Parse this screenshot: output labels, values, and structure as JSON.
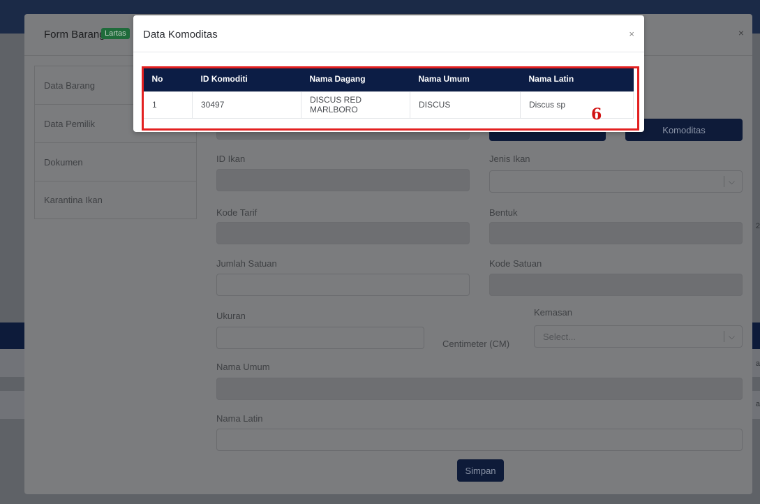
{
  "background": {
    "edge_text_1": "2",
    "edge_text_2": "a",
    "edge_text_3": "a"
  },
  "form": {
    "title": "Form Barang",
    "badge": "Lartas",
    "close": "×",
    "side_nav": [
      "Data Barang",
      "Data Pemilik",
      "Dokumen",
      "Karantina Ikan"
    ],
    "fields": {
      "id_ikan": {
        "label": "ID Ikan",
        "value": ""
      },
      "jenis_ikan": {
        "label": "Jenis Ikan",
        "value": ""
      },
      "kode_tarif": {
        "label": "Kode Tarif",
        "value": ""
      },
      "bentuk": {
        "label": "Bentuk",
        "value": ""
      },
      "jumlah_satuan": {
        "label": "Jumlah Satuan",
        "value": ""
      },
      "kode_satuan": {
        "label": "Kode Satuan",
        "value": ""
      },
      "ukuran": {
        "label": "Ukuran",
        "value": "",
        "unit": "Centimeter (CM)"
      },
      "kemasan": {
        "label": "Kemasan",
        "placeholder": "Select..."
      },
      "nama_umum": {
        "label": "Nama Umum",
        "value": ""
      },
      "nama_latin": {
        "label": "Nama Latin",
        "value": ""
      }
    },
    "buttons": {
      "komoditas": "Komoditas",
      "simpan": "Simpan"
    }
  },
  "dialog": {
    "title": "Data Komoditas",
    "close": "×",
    "columns": [
      "No",
      "ID Komoditi",
      "Nama Dagang",
      "Nama Umum",
      "Nama Latin"
    ],
    "rows": [
      [
        "1",
        "30497",
        "DISCUS RED MARLBORO",
        "DISCUS",
        "Discus sp"
      ]
    ]
  },
  "annotation": {
    "number": "6",
    "color": "#e32020"
  },
  "colors": {
    "navy": "#0c1d45",
    "badge_green": "#1f6b3b"
  },
  "icons": {
    "caret": "chevron-down-icon"
  }
}
